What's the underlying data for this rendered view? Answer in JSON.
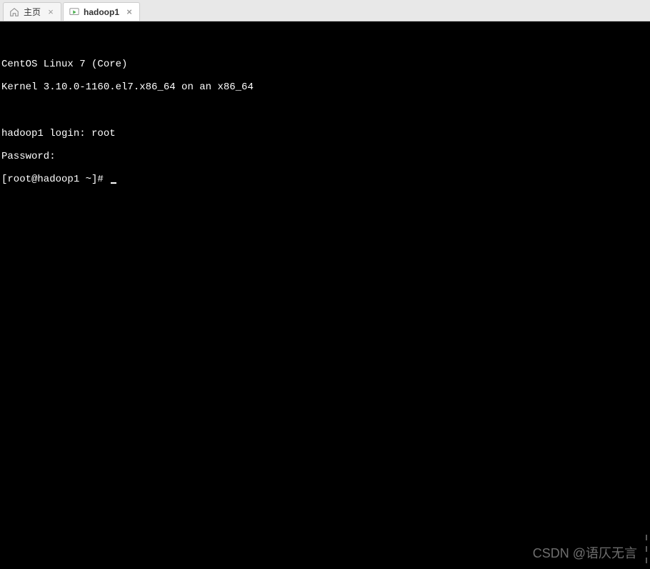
{
  "tabs": [
    {
      "label": "主页",
      "icon": "home",
      "active": false
    },
    {
      "label": "hadoop1",
      "icon": "vm",
      "active": true
    }
  ],
  "terminal": {
    "lines": [
      "",
      "CentOS Linux 7 (Core)",
      "Kernel 3.10.0-1160.el7.x86_64 on an x86_64",
      "",
      "hadoop1 login: root",
      "Password:",
      "[root@hadoop1 ~]# "
    ]
  },
  "watermark": "CSDN @语仄无言"
}
